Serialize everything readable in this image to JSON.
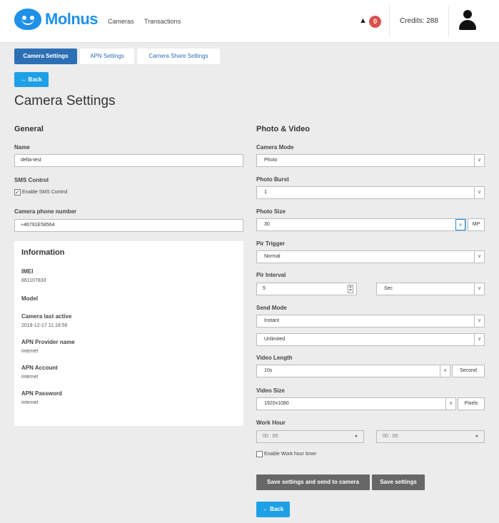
{
  "header": {
    "brand": "Molnus",
    "nav": [
      "Cameras",
      "Transactions"
    ],
    "notification_count": "0",
    "credits": "Credits: 288"
  },
  "tabs": [
    "Camera Settings",
    "APN Settings",
    "Camera Share Settings"
  ],
  "back_label": "← Back",
  "page_title": "Camera Settings",
  "general": {
    "title": "General",
    "name_label": "Name",
    "name_value": "delta-test",
    "sms_label": "SMS Control",
    "sms_checkbox": "Enable SMS Control",
    "phone_label": "Camera phone number",
    "phone_value": "+46791E58564"
  },
  "information": {
    "title": "Information",
    "items": [
      {
        "label": "IMEI",
        "value": "861107833"
      },
      {
        "label": "Model",
        "value": ""
      },
      {
        "label": "Camera last active",
        "value": "2018-12-17 11:18:56"
      },
      {
        "label": "APN Provider name",
        "value": "internet"
      },
      {
        "label": "APN Account",
        "value": "internet"
      },
      {
        "label": "APN Password",
        "value": "internet"
      }
    ]
  },
  "photo_video": {
    "title": "Photo & Video",
    "camera_mode_label": "Camera Mode",
    "camera_mode": "Photo",
    "photo_burst_label": "Photo Burst",
    "photo_burst": "1",
    "photo_size_label": "Photo Size",
    "photo_size": "30",
    "photo_size_unit": "MP",
    "pir_trigger_label": "Pir Trigger",
    "pir_trigger": "Normal",
    "pir_interval_label": "Pir Interval",
    "pir_interval": "5",
    "pir_interval_unit": "Sec",
    "send_mode_label": "Send Mode",
    "send_mode": "Instant",
    "send_mode_limit": "Unlimited",
    "video_length_label": "Video Length",
    "video_length": "10s",
    "video_length_unit": "Second",
    "video_size_label": "Video Size",
    "video_size": "1920x1080",
    "video_size_unit": "Pixels",
    "work_hour_label": "Work Hour",
    "work_hour_start": "00 : 00",
    "work_hour_end": "00 : 00",
    "work_hour_checkbox": "Enable Work hour timer"
  },
  "actions": {
    "save_send": "Save settings and send to camera",
    "save": "Save settings",
    "back": "← Back"
  },
  "colors": {
    "brand": "#1e90e8",
    "tab_active": "#2d6fb5",
    "button_blue": "#1ea0e6",
    "button_dark": "#676767",
    "notification": "#d9534f"
  }
}
